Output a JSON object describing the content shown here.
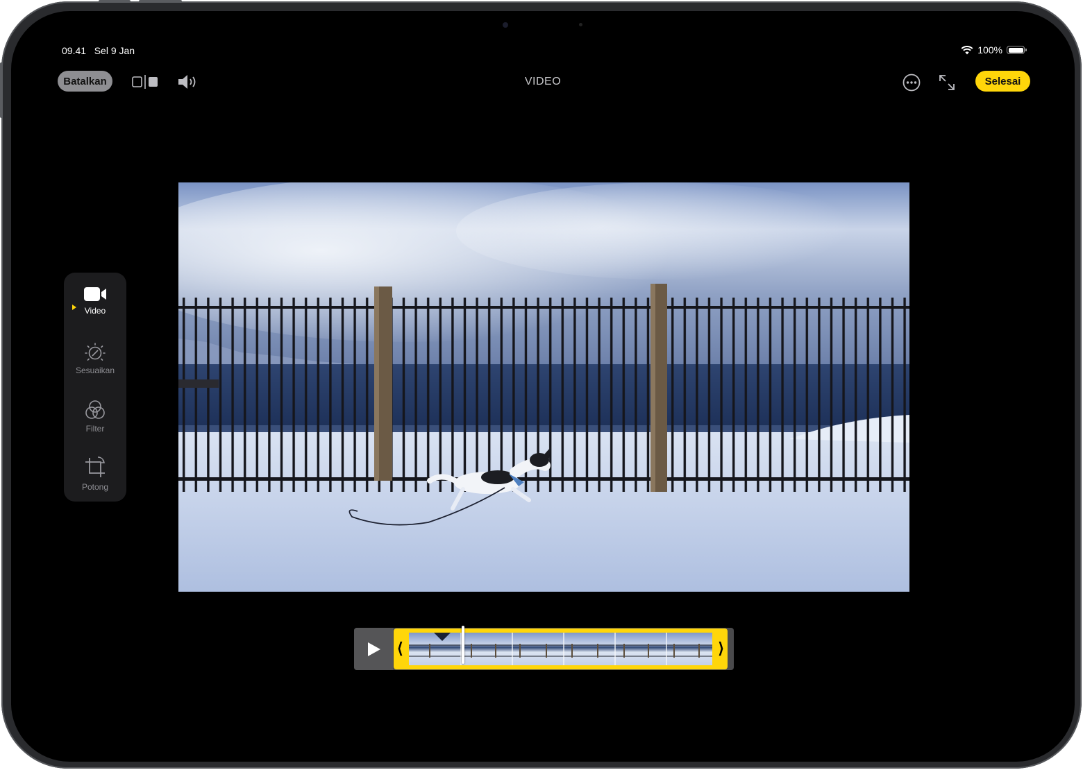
{
  "status_bar": {
    "time": "09.41",
    "date": "Sel 9 Jan",
    "battery": "100%"
  },
  "toolbar": {
    "cancel_label": "Batalkan",
    "title": "VIDEO",
    "done_label": "Selesai"
  },
  "tools": [
    {
      "label": "Video",
      "icon": "video-camera-icon",
      "active": true
    },
    {
      "label": "Sesuaikan",
      "icon": "adjust-dial-icon",
      "active": false
    },
    {
      "label": "Filter",
      "icon": "filter-circles-icon",
      "active": false
    },
    {
      "label": "Potong",
      "icon": "crop-icon",
      "active": false
    }
  ],
  "colors": {
    "accent": "#ffd60a",
    "background": "#000000",
    "panel": "#1c1c1e"
  }
}
